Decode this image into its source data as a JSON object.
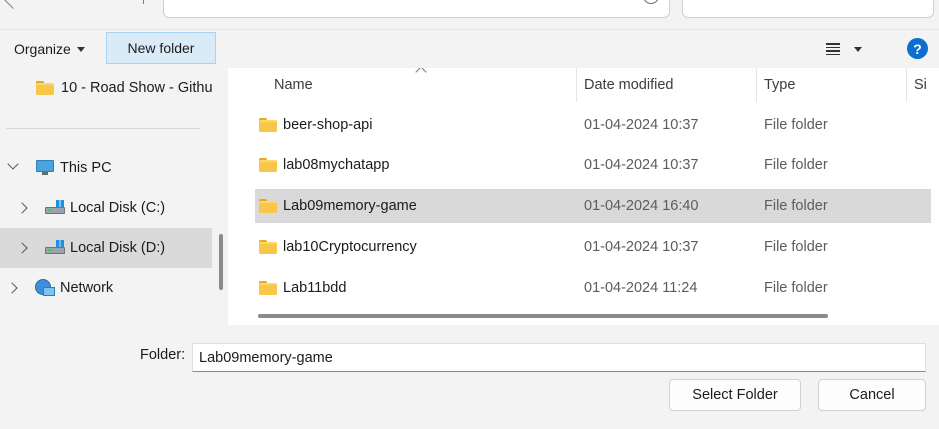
{
  "toolbar": {
    "organize_label": "Organize",
    "new_folder_label": "New folder"
  },
  "nav": {
    "items": [
      {
        "label": "10 - Road Show - Githu",
        "icon": "folder-icon"
      },
      {
        "label": "This PC",
        "icon": "pc-icon"
      },
      {
        "label": "Local Disk (C:)",
        "icon": "drive-icon"
      },
      {
        "label": "Local Disk (D:)",
        "icon": "drive-icon",
        "selected": true
      },
      {
        "label": "Network",
        "icon": "network-icon"
      }
    ]
  },
  "columns": {
    "name": "Name",
    "date": "Date modified",
    "type": "Type",
    "size": "Si"
  },
  "files": [
    {
      "name": "beer-shop-api",
      "date": "01-04-2024 10:37",
      "type": "File folder"
    },
    {
      "name": "lab08mychatapp",
      "date": "01-04-2024 10:37",
      "type": "File folder"
    },
    {
      "name": "Lab09memory-game",
      "date": "01-04-2024 16:40",
      "type": "File folder",
      "selected": true
    },
    {
      "name": "lab10Cryptocurrency",
      "date": "01-04-2024 10:37",
      "type": "File folder"
    },
    {
      "name": "Lab11bdd",
      "date": "01-04-2024 11:24",
      "type": "File folder"
    }
  ],
  "footer": {
    "folder_label": "Folder:",
    "folder_value": "Lab09memory-game",
    "select_label": "Select Folder",
    "cancel_label": "Cancel"
  },
  "help_glyph": "?"
}
